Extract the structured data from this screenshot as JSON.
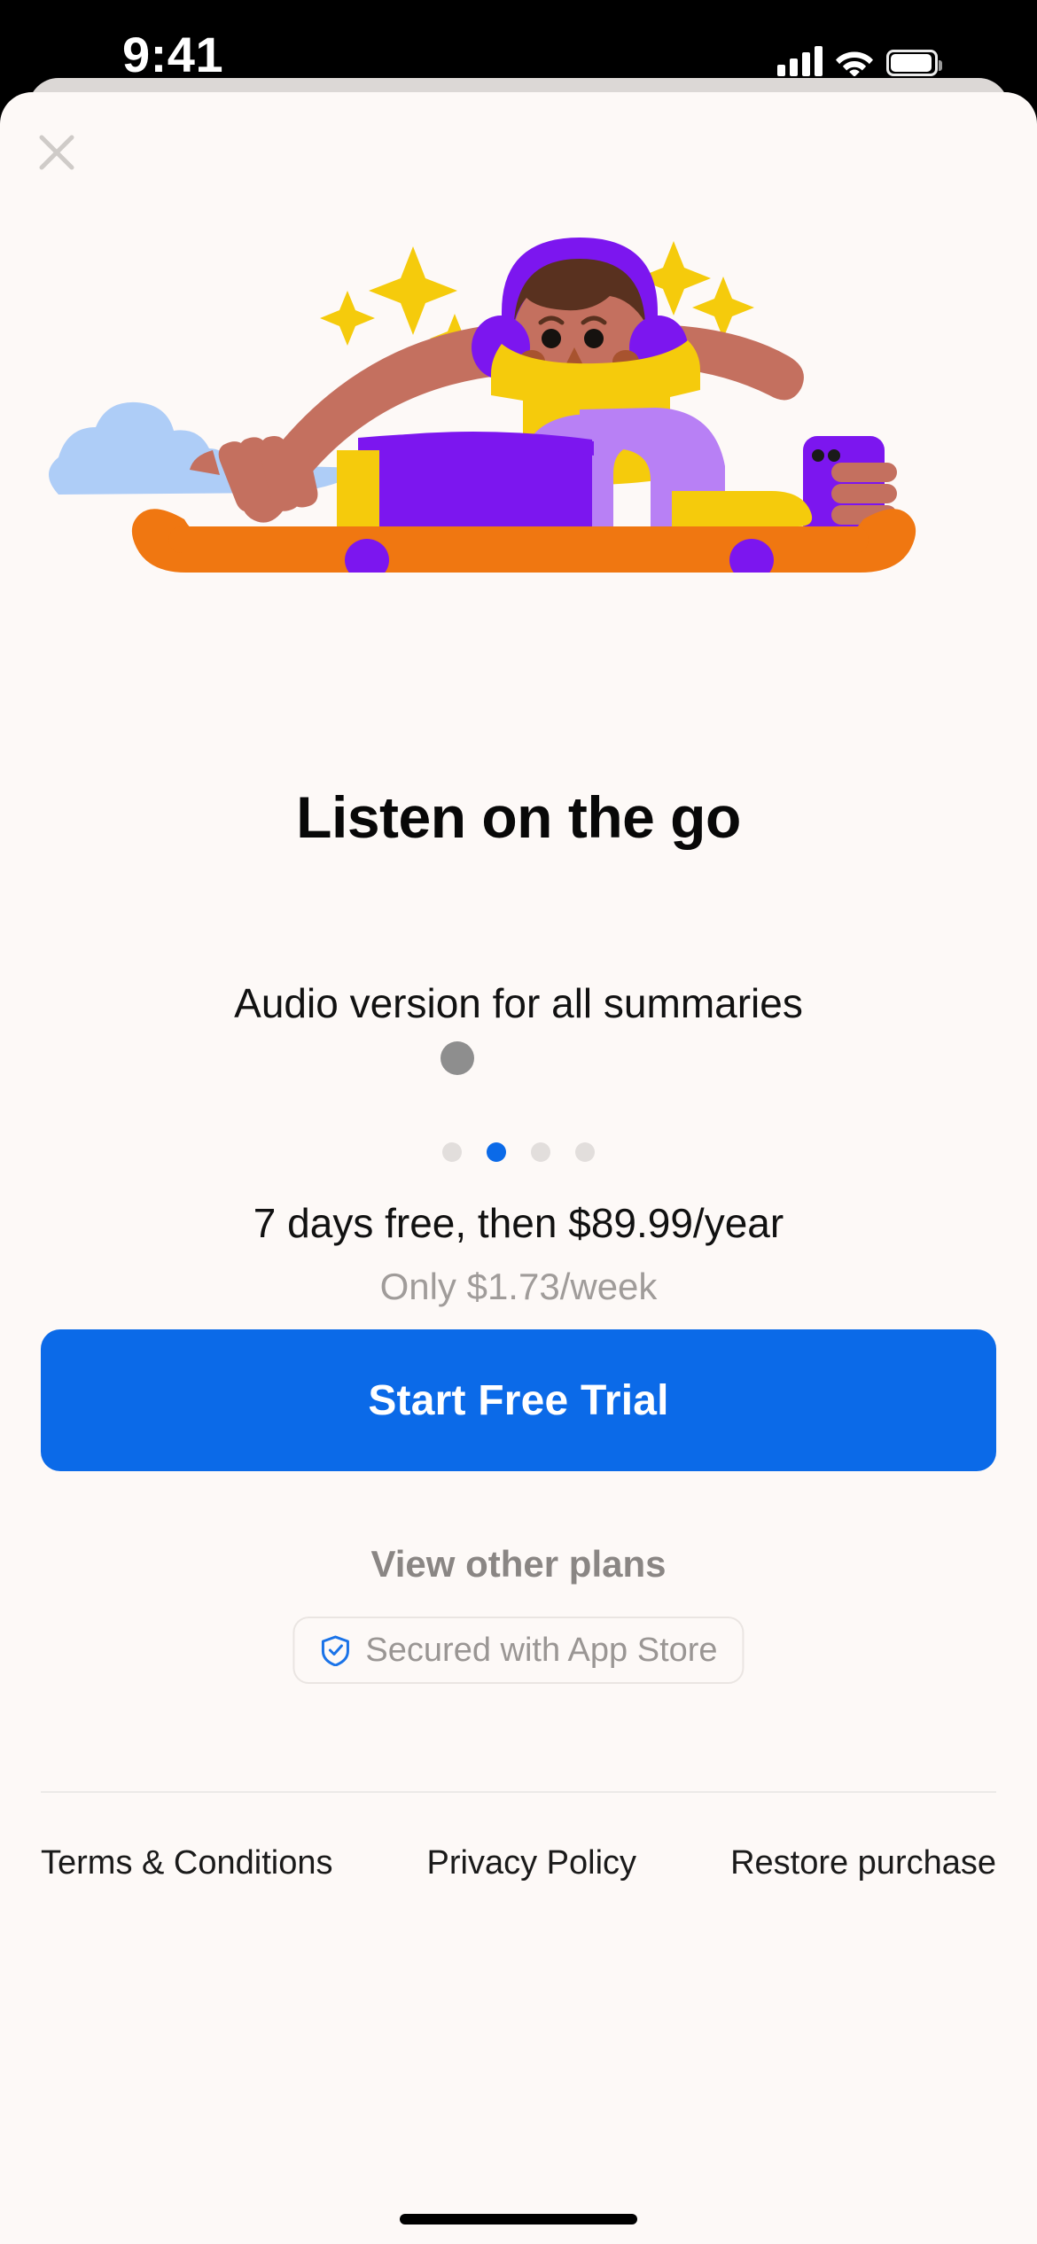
{
  "status_bar": {
    "time": "9:41",
    "cellular_icon": "cellular-bars-icon",
    "wifi_icon": "wifi-icon",
    "battery_icon": "battery-icon"
  },
  "paywall": {
    "close_icon": "close-icon",
    "illustration": {
      "name": "person-skateboarding-with-headphones-illustration",
      "colors": {
        "skin": "#c4705f",
        "hair": "#59311f",
        "shirt": "#f5cb0c",
        "pants": "#b880f5",
        "shorts": "#7c16ef",
        "headphones": "#7c16ef",
        "headphone_rim": "#f07c1a",
        "phone": "#7c16ef",
        "board": "#f07711",
        "wheels": "#7c16ef",
        "shoes": "#f5cb0c",
        "sparkles": "#f5cb0c",
        "cloud": "#aecdf7",
        "background": "#fdf9f7"
      }
    },
    "headline": "Listen on the go",
    "subhead": "Audio version for all summaries",
    "carousel": {
      "total": 4,
      "active_index": 1
    },
    "price_main": "7 days free, then $89.99/year",
    "price_sub": "Only $1.73/week",
    "cta_label": "Start Free Trial",
    "other_plans_label": "View other plans",
    "secured": {
      "icon": "shield-check-icon",
      "label": "Secured with App Store",
      "icon_color": "#1a73e8"
    },
    "footer_links": [
      "Terms & Conditions",
      "Privacy Policy",
      "Restore purchase"
    ],
    "accent_color": "#0b6ae8",
    "sheet_background": "#fdf9f7"
  }
}
